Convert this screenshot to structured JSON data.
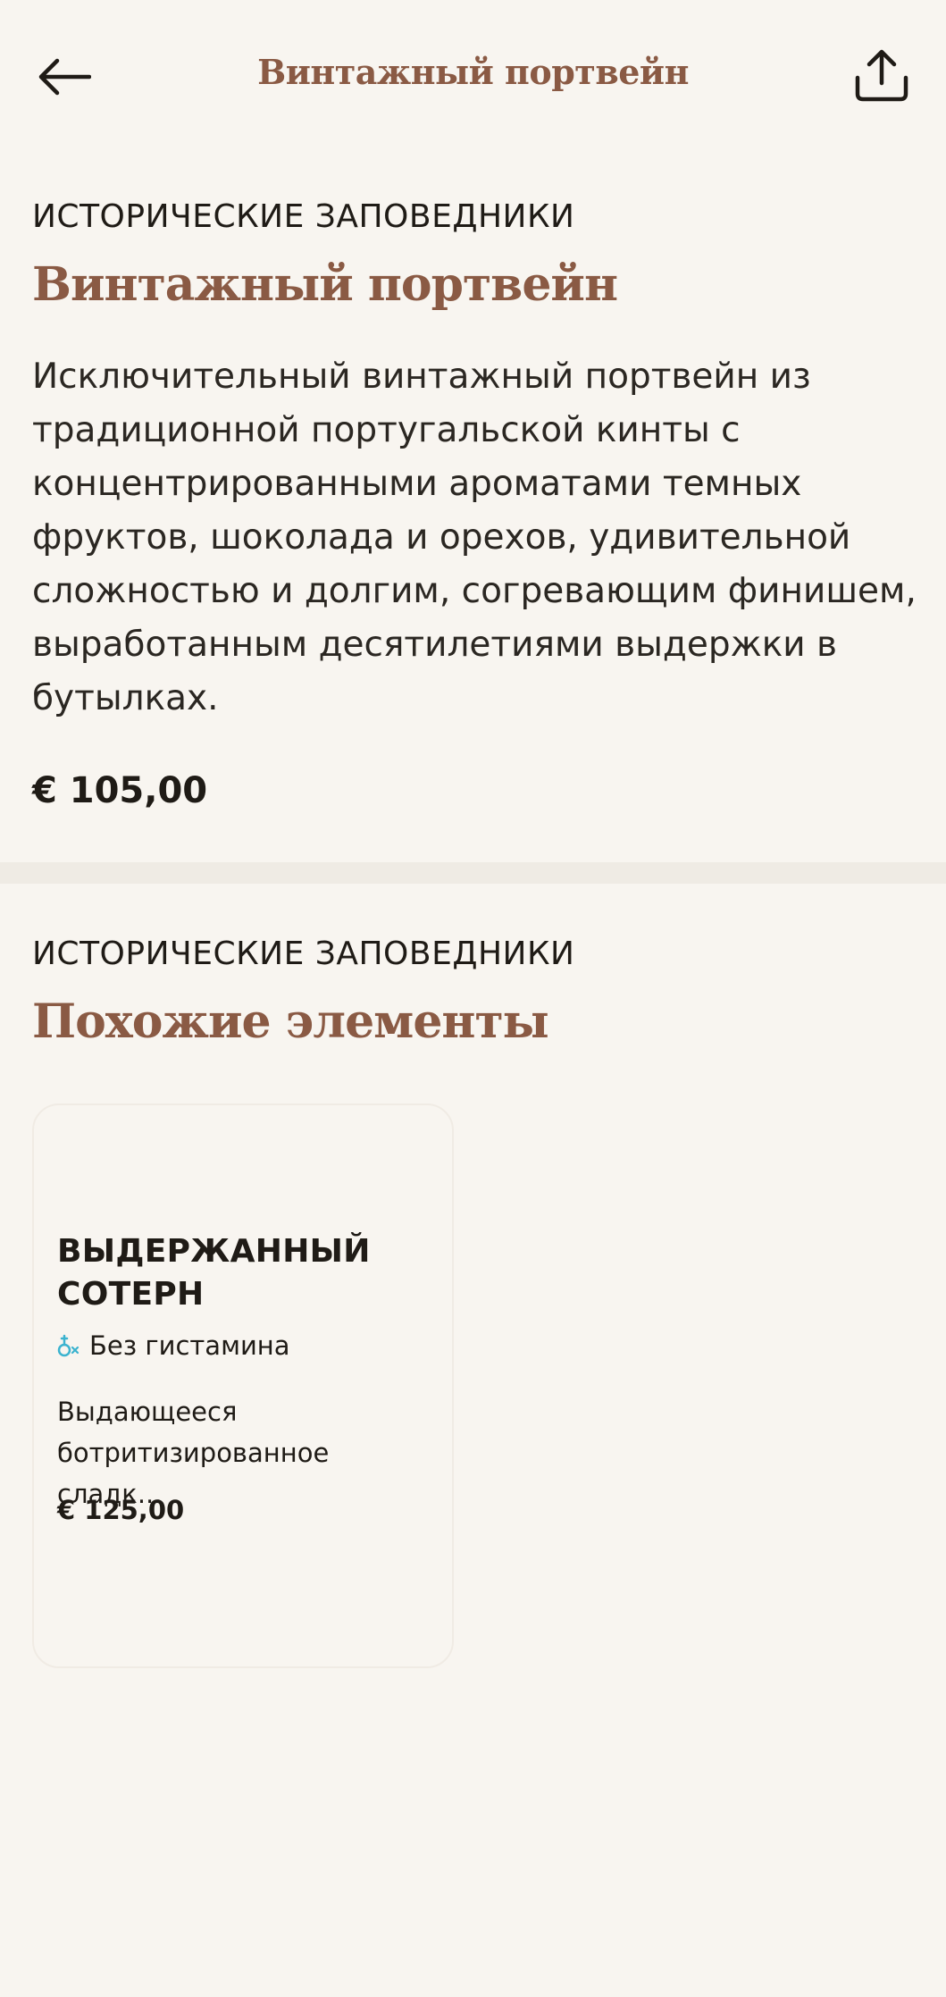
{
  "header": {
    "title": "Винтажный портвейн",
    "back_icon": "arrow-left-icon",
    "share_icon": "share-icon"
  },
  "product": {
    "category": "ИСТОРИЧЕСКИЕ ЗАПОВЕДНИКИ",
    "name": "Винтажный портвейн",
    "description": "Исключительный винтажный портвейн из традиционной португальской кинты с концентрированными ароматами темных фруктов, шоколада и орехов, удивительной сложностью и долгим, согревающим финишем, выработанным десятилетиями выдержки в бутылках.",
    "price": "€ 105,00"
  },
  "related": {
    "category": "ИСТОРИЧЕСКИЕ ЗАПОВЕДНИКИ",
    "title": "Похожие элементы",
    "items": [
      {
        "name": "ВЫДЕРЖАННЫЙ СОТЕРН",
        "badge": "Без гистамина",
        "badge_icon": "histamine-free-icon",
        "description": "Выдающееся ботритизированное сладк...",
        "price": "€ 125,00"
      }
    ]
  },
  "colors": {
    "background": "#f8f5f0",
    "accent": "#8a5a44",
    "divider": "#efebe4",
    "badge_icon": "#3bb3cf"
  }
}
